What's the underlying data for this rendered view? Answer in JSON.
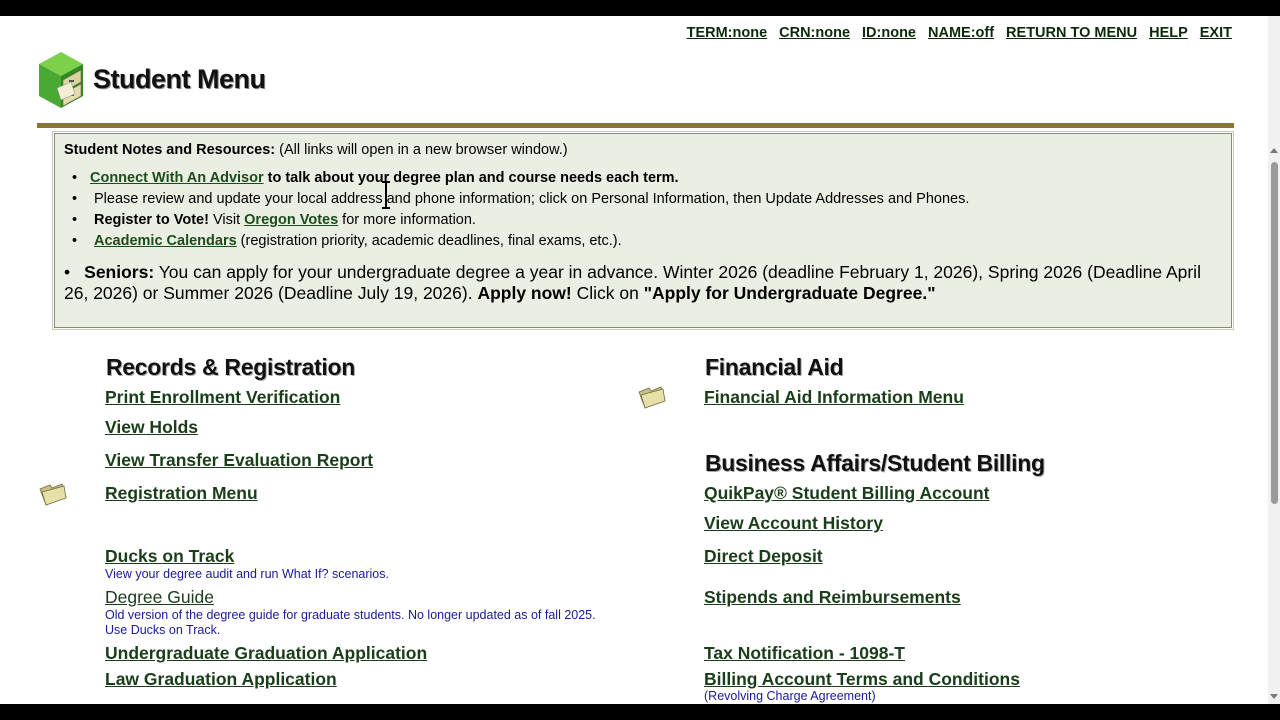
{
  "top_nav": {
    "term": "TERM:none",
    "crn": "CRN:none",
    "id": "ID:none",
    "name": "NAME:off",
    "return": "RETURN TO MENU",
    "help": "HELP",
    "exit": "EXIT"
  },
  "header": {
    "title": "Student Menu",
    "logo_icon": "filing-cabinet-icon"
  },
  "notes": {
    "heading_bold": "Student Notes and Resources:",
    "heading_rest": " (All links will open in a new browser window.)",
    "items": [
      {
        "link": "Connect With An Advisor",
        "text": " to talk about your degree plan and course needs each term."
      },
      {
        "text": "Please review and update your local address and phone information; click on Personal Information, then Update Addresses and Phones."
      },
      {
        "bold": "Register to Vote!",
        "pre": " Visit ",
        "link": "Oregon Votes",
        "text": " for more information."
      },
      {
        "link": "Academic Calendars",
        "text": " (registration priority, academic deadlines, final exams, etc.)."
      }
    ],
    "seniors": {
      "label": "Seniors:",
      "text": " You can apply for your undergraduate degree a year in advance. Winter 2026 (deadline February 1, 2026), Spring 2026 (Deadline April 26, 2026) or Summer 2026 (Deadline July 19, 2026). ",
      "apply": "Apply now!",
      "click": " Click on ",
      "quote": "\"Apply for Undergraduate Degree.\""
    }
  },
  "left_column": {
    "heading": "Records & Registration",
    "links": [
      "Print Enrollment Verification",
      "View Holds",
      "View Transfer Evaluation Report",
      "Registration Menu",
      "Ducks on Track",
      "Degree Guide",
      "Undergraduate Graduation Application",
      "Law Graduation Application"
    ],
    "ducks_desc": "View your degree audit and run What If? scenarios.",
    "guide_desc_1": "Old version of the degree guide for graduate students. No longer updated as of fall 2025.",
    "guide_desc_2": "Use Ducks on Track."
  },
  "right_column": {
    "fin_heading": "Financial Aid",
    "fin_link": "Financial Aid Information Menu",
    "biz_heading": "Business Affairs/Student Billing",
    "biz_links": [
      "QuikPay® Student Billing Account",
      "View Account History",
      "Direct Deposit",
      "Stipends and Reimbursements",
      "Tax Notification - 1098-T",
      "Billing Account Terms and Conditions"
    ],
    "billing_desc": "(Revolving Charge Agreement)"
  },
  "colors": {
    "link": "#1a3d1a",
    "rule": "#8b7536",
    "notes_bg": "#ebeee2",
    "desc": "#1a1a9a"
  },
  "icons": [
    "filing-cabinet-icon",
    "folder-icon",
    "text-cursor-icon"
  ]
}
